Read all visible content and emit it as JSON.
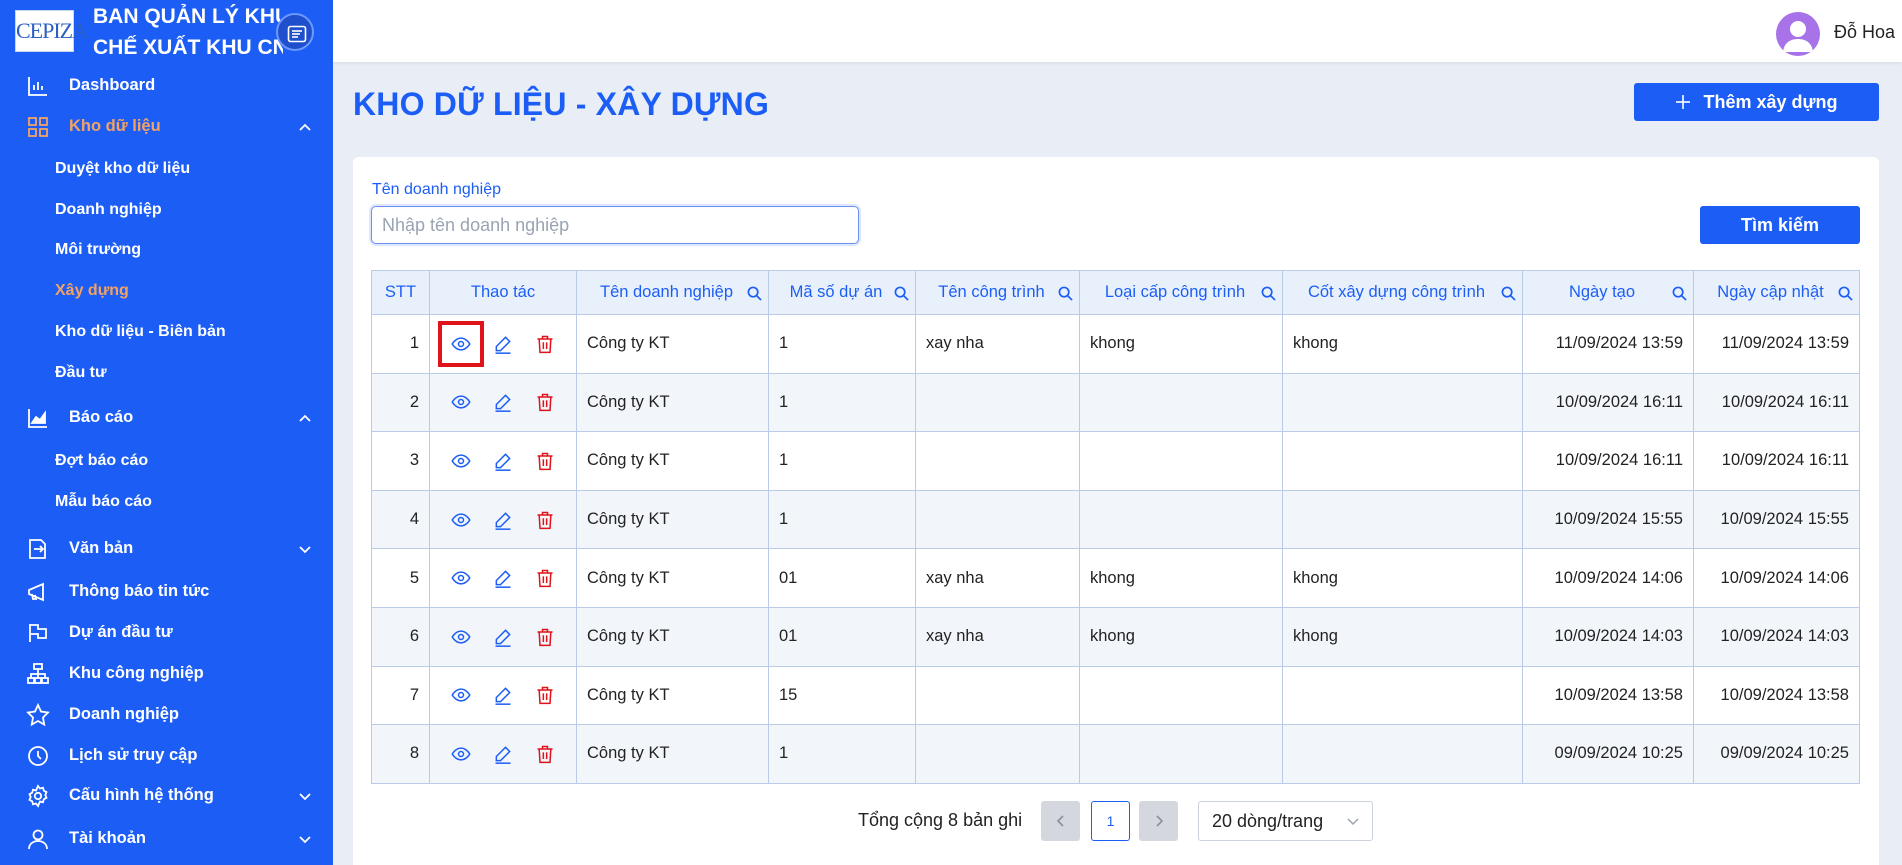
{
  "brand": {
    "logo_text": "CEPIZA",
    "title_line1": "BAN QUẢN LÝ KHU",
    "title_line2": "CHẾ XUẤT KHU CN"
  },
  "sidebar": {
    "items": [
      {
        "label": "Dashboard",
        "icon": "bar-chart-icon"
      },
      {
        "label": "Kho dữ liệu",
        "icon": "grid-icon",
        "expanded": true,
        "children": [
          "Duyệt kho dữ liệu",
          "Doanh nghiệp",
          "Môi trường",
          "Xây dựng",
          "Kho dữ liệu - Biên bản",
          "Đầu tư"
        ]
      },
      {
        "label": "Báo cáo",
        "icon": "area-chart-icon",
        "expanded": true,
        "children": [
          "Đợt báo cáo",
          "Mẫu báo cáo"
        ]
      },
      {
        "label": "Văn bản",
        "icon": "document-arrow-icon"
      },
      {
        "label": "Thông báo tin tức",
        "icon": "megaphone-icon"
      },
      {
        "label": "Dự án đầu tư",
        "icon": "flag-icon"
      },
      {
        "label": "Khu công nghiệp",
        "icon": "cluster-icon"
      },
      {
        "label": "Doanh nghiệp",
        "icon": "star-icon"
      },
      {
        "label": "Lịch sử truy cập",
        "icon": "clock-icon"
      },
      {
        "label": "Cấu hình hệ thống",
        "icon": "gear-icon"
      },
      {
        "label": "Tài khoản",
        "icon": "user-icon"
      }
    ],
    "active_item": "Kho dữ liệu",
    "active_subitem": "Xây dựng"
  },
  "header": {
    "username": "Đỗ Hoa"
  },
  "page": {
    "title": "KHO DỮ LIỆU - XÂY DỰNG",
    "add_button": "Thêm xây dựng"
  },
  "filter": {
    "label": "Tên doanh nghiệp",
    "placeholder": "Nhập tên doanh nghiệp",
    "value": "",
    "search_button": "Tìm kiếm"
  },
  "table": {
    "columns": [
      "STT",
      "Thao tác",
      "Tên doanh nghiệp",
      "Mã số dự án",
      "Tên công trình",
      "Loại cấp công trình",
      "Cốt xây dựng công trình",
      "Ngày tạo",
      "Ngày cập nhật"
    ],
    "rows": [
      {
        "stt": "1",
        "company": "Công ty KT",
        "project_code": "1",
        "work_name": "xay nha",
        "work_level": "khong",
        "elevation": "khong",
        "created": "11/09/2024 13:59",
        "updated": "11/09/2024 13:59"
      },
      {
        "stt": "2",
        "company": "Công ty KT",
        "project_code": "1",
        "work_name": "",
        "work_level": "",
        "elevation": "",
        "created": "10/09/2024 16:11",
        "updated": "10/09/2024 16:11"
      },
      {
        "stt": "3",
        "company": "Công ty KT",
        "project_code": "1",
        "work_name": "",
        "work_level": "",
        "elevation": "",
        "created": "10/09/2024 16:11",
        "updated": "10/09/2024 16:11"
      },
      {
        "stt": "4",
        "company": "Công ty KT",
        "project_code": "1",
        "work_name": "",
        "work_level": "",
        "elevation": "",
        "created": "10/09/2024 15:55",
        "updated": "10/09/2024 15:55"
      },
      {
        "stt": "5",
        "company": "Công ty KT",
        "project_code": "01",
        "work_name": "xay nha",
        "work_level": "khong",
        "elevation": "khong",
        "created": "10/09/2024 14:06",
        "updated": "10/09/2024 14:06"
      },
      {
        "stt": "6",
        "company": "Công ty KT",
        "project_code": "01",
        "work_name": "xay nha",
        "work_level": "khong",
        "elevation": "khong",
        "created": "10/09/2024 14:03",
        "updated": "10/09/2024 14:03"
      },
      {
        "stt": "7",
        "company": "Công ty KT",
        "project_code": "15",
        "work_name": "",
        "work_level": "",
        "elevation": "",
        "created": "10/09/2024 13:58",
        "updated": "10/09/2024 13:58"
      },
      {
        "stt": "8",
        "company": "Công ty KT",
        "project_code": "1",
        "work_name": "",
        "work_level": "",
        "elevation": "",
        "created": "09/09/2024 10:25",
        "updated": "09/09/2024 10:25"
      }
    ]
  },
  "pagination": {
    "total_text": "Tổng cộng 8 bản ghi",
    "current_page": "1",
    "page_size": "20 dòng/trang"
  },
  "colors": {
    "primary": "#1c5ef5",
    "active_menu": "#f4a261",
    "delete": "#e0121a",
    "highlight": "#e0121a"
  }
}
